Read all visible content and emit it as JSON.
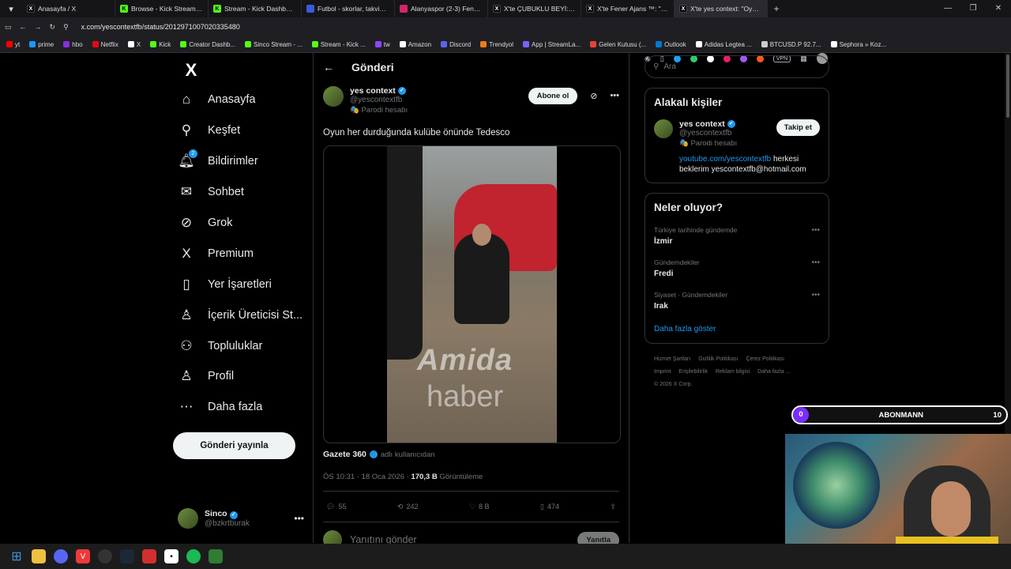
{
  "browser": {
    "tabs": [
      {
        "title": "Anasayfa / X",
        "color": "#000000",
        "glyph": "X"
      },
      {
        "title": "Browse - Kick Streaming",
        "color": "#53fc18",
        "glyph": "K"
      },
      {
        "title": "Stream - Kick Dashboard",
        "color": "#53fc18",
        "glyph": "K"
      },
      {
        "title": "Futbol - skorlar, takvim & o",
        "color": "#3a5bd8",
        "glyph": ""
      },
      {
        "title": "Alanyaspor (2-3) Fenerbah",
        "color": "#d0266b",
        "glyph": ""
      },
      {
        "title": "X'te ÇUBUKLU BEYİ: \"Talisc",
        "color": "#000000",
        "glyph": "X"
      },
      {
        "title": "X'te Fener Ajans ™: \"SON D",
        "color": "#000000",
        "glyph": "X"
      },
      {
        "title": "X'te yes context: \"Oyun her",
        "color": "#000000",
        "glyph": "X"
      }
    ],
    "url": "x.com/yescontextfb/status/2012971007020335480",
    "bookmarks": [
      {
        "label": "yt",
        "color": "#ff0000"
      },
      {
        "label": "prime",
        "color": "#1a98ff"
      },
      {
        "label": "hbo",
        "color": "#8a2be2"
      },
      {
        "label": "Netflix",
        "color": "#e50914"
      },
      {
        "label": "X",
        "color": "#ffffff"
      },
      {
        "label": "Kick",
        "color": "#53fc18"
      },
      {
        "label": "Creator Dashb...",
        "color": "#53fc18"
      },
      {
        "label": "Sinco Stream - ...",
        "color": "#53fc18"
      },
      {
        "label": "Stream - Kick ...",
        "color": "#53fc18"
      },
      {
        "label": "tw",
        "color": "#9146ff"
      },
      {
        "label": "Amazon",
        "color": "#ffffff"
      },
      {
        "label": "Discord",
        "color": "#5865f2"
      },
      {
        "label": "Trendyol",
        "color": "#f27a1a"
      },
      {
        "label": "App | StreamLa...",
        "color": "#7b61ff"
      },
      {
        "label": "Gelen Kutusu (...",
        "color": "#ea4335"
      },
      {
        "label": "Outlook",
        "color": "#0078d4"
      },
      {
        "label": "Adidas Legtea ...",
        "color": "#ffffff"
      },
      {
        "label": "BTCUSD.P 92.7...",
        "color": "#cccccc"
      },
      {
        "label": "Sephora » Koz...",
        "color": "#ffffff"
      }
    ]
  },
  "sidebar": {
    "logo": "X",
    "items": [
      {
        "label": "Anasayfa",
        "icon": "home-icon"
      },
      {
        "label": "Keşfet",
        "icon": "search-icon"
      },
      {
        "label": "Bildirimler",
        "icon": "bell-icon",
        "badge": "2"
      },
      {
        "label": "Sohbet",
        "icon": "mail-icon"
      },
      {
        "label": "Grok",
        "icon": "grok-icon"
      },
      {
        "label": "Premium",
        "icon": "x-premium-icon"
      },
      {
        "label": "Yer İşaretleri",
        "icon": "bookmark-icon"
      },
      {
        "label": "İçerik Üreticisi St...",
        "icon": "creator-icon"
      },
      {
        "label": "Topluluklar",
        "icon": "communities-icon"
      },
      {
        "label": "Profil",
        "icon": "profile-icon"
      },
      {
        "label": "Daha fazla",
        "icon": "more-circle-icon"
      }
    ],
    "post_button": "Gönderi yayınla",
    "account": {
      "name": "Sinco",
      "handle": "@bzkrtburak"
    }
  },
  "main": {
    "header": "Gönderi",
    "post": {
      "author": "yes context",
      "handle": "@yescontextfb",
      "parody": "Parodi hesabı",
      "subscribe": "Abone ol",
      "text": "Oyun her durduğunda kulübe önünde Tedesco",
      "watermark1": "Amida",
      "watermark2": "haber",
      "source_name": "Gazete 360",
      "source_suffix": "adlı kullanıcıdan",
      "time": "ÖS 10:31 · 18 Oca 2026 ·",
      "views": "170,3 B",
      "views_label": "Görüntüleme",
      "replies": "55",
      "reposts": "242",
      "likes": "8 B",
      "bookmarks": "474"
    },
    "reply_placeholder": "Yanıtını gönder",
    "reply_button": "Yanıtla"
  },
  "right": {
    "search_placeholder": "Ara",
    "related_title": "Alakalı kişiler",
    "related": {
      "name": "yes context",
      "handle": "@yescontextfb",
      "parody": "Parodi hesabı",
      "follow": "Takip et",
      "bio_link": "youtube.com/yescontextfb",
      "bio_text": " herkesi beklerim yescontextfb@hotmail.com"
    },
    "trends_title": "Neler oluyor?",
    "trends": [
      {
        "category": "Türkiye tarihinde gündemde",
        "name": "İzmir"
      },
      {
        "category": "Gündemdekiler",
        "name": "Fredi"
      },
      {
        "category": "Siyaset · Gündemdekiler",
        "name": "Irak"
      }
    ],
    "show_more": "Daha fazla göster",
    "footer": [
      "Hizmet Şartları",
      "Gizlilik Politikası",
      "Çerez Politikası",
      "Imprint",
      "Erişilebilirlik",
      "Reklam bilgisi",
      "Daha fazla ...",
      "© 2026 X Corp."
    ]
  },
  "overlay": {
    "sub_left": "0",
    "sub_label": "ABONMANN",
    "sub_right": "10"
  }
}
